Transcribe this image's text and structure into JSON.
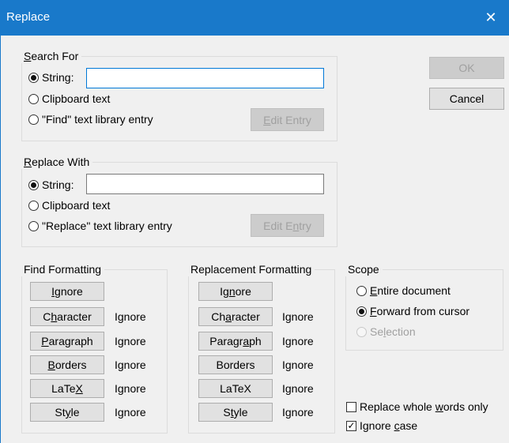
{
  "window": {
    "title": "Replace",
    "close_glyph": "✕"
  },
  "search_for": {
    "title_pre": "",
    "title_u": "S",
    "title_post": "earch For",
    "options": [
      {
        "label": "String:",
        "selected": true
      },
      {
        "label": "Clipboard text",
        "selected": false
      },
      {
        "label": "\"Find\" text library entry",
        "selected": false
      }
    ],
    "string_value": "",
    "edit_entry": {
      "pre": "",
      "u": "E",
      "post": "dit Entry",
      "enabled": false
    }
  },
  "replace_with": {
    "title_pre": "",
    "title_u": "R",
    "title_post": "eplace With",
    "options": [
      {
        "label": "String:",
        "selected": true
      },
      {
        "label": "Clipboard text",
        "selected": false
      },
      {
        "label": "\"Replace\" text library entry",
        "selected": false
      }
    ],
    "string_value": "",
    "edit_entry": {
      "pre": "Edit E",
      "u": "n",
      "post": "try",
      "enabled": false
    }
  },
  "buttons": {
    "ok": "OK",
    "cancel": "Cancel"
  },
  "find_formatting": {
    "title": "Find Formatting",
    "ignore": {
      "pre": "",
      "u": "I",
      "post": "gnore"
    },
    "rows": [
      {
        "pre": "C",
        "u": "h",
        "post": "aracter",
        "status": "Ignore"
      },
      {
        "pre": "",
        "u": "P",
        "post": "aragraph",
        "status": "Ignore"
      },
      {
        "pre": "",
        "u": "B",
        "post": "orders",
        "status": "Ignore"
      },
      {
        "pre": "LaTe",
        "u": "X",
        "post": "",
        "status": "Ignore"
      },
      {
        "pre": "St",
        "u": "y",
        "post": "le",
        "status": "Ignore"
      }
    ]
  },
  "replacement_formatting": {
    "title": "Replacement Formatting",
    "ignore": {
      "pre": "Ig",
      "u": "n",
      "post": "ore"
    },
    "rows": [
      {
        "pre": "Ch",
        "u": "a",
        "post": "racter",
        "status": "Ignore"
      },
      {
        "pre": "Paragr",
        "u": "a",
        "post": "ph",
        "status": "Ignore"
      },
      {
        "pre": "Borders",
        "u": "",
        "post": "",
        "status": "Ignore"
      },
      {
        "pre": "LaTeX",
        "u": "",
        "post": "",
        "status": "Ignore"
      },
      {
        "pre": "S",
        "u": "t",
        "post": "yle",
        "status": "Ignore"
      }
    ]
  },
  "scope": {
    "title": "Scope",
    "options": [
      {
        "pre": "",
        "u": "E",
        "post": "ntire document",
        "selected": false,
        "enabled": true
      },
      {
        "pre": "",
        "u": "F",
        "post": "orward from cursor",
        "selected": true,
        "enabled": true
      },
      {
        "pre": "Se",
        "u": "l",
        "post": "ection",
        "selected": false,
        "enabled": false
      }
    ]
  },
  "checkboxes": {
    "whole_words": {
      "pre": "Replace whole ",
      "u": "w",
      "post": "ords only",
      "checked": false
    },
    "ignore_case": {
      "pre": "Ignore ",
      "u": "c",
      "post": "ase",
      "checked": true,
      "mark": "✓"
    }
  }
}
